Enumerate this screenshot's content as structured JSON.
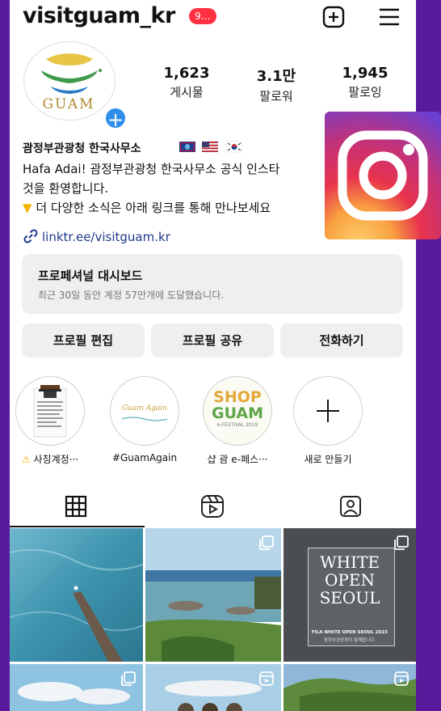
{
  "header": {
    "username": "visitguam_kr",
    "notification_badge": "9…",
    "icons": [
      "plus-square-icon",
      "menu-icon"
    ]
  },
  "profile": {
    "avatar_text": "GUAM",
    "stats": [
      {
        "value": "1,623",
        "label": "게시물"
      },
      {
        "value": "3.1만",
        "label": "팔로워"
      },
      {
        "value": "1,945",
        "label": "팔로잉"
      }
    ],
    "name": "괌정부관광청 한국사무소",
    "bio_lines": [
      "Hafa Adai! 괌정부관광청 한국사무소 공식 인스타",
      "것을 환영합니다.",
      "더 다양한 소식은 아래 링크를 통해 만나보세요"
    ],
    "link": "linktr.ee/visitguam.kr"
  },
  "dashboard": {
    "title": "프로페셔널 대시보드",
    "subtitle": "최근 30일 동안 계정 57만개에 도달했습니다."
  },
  "actions": {
    "edit": "프로필 편집",
    "share": "프로필 공유",
    "call": "전화하기"
  },
  "highlights": [
    {
      "label": "사칭계정···"
    },
    {
      "label": "#GuamAgain",
      "cover_text": "Guam Again"
    },
    {
      "label": "샵 괌 e-페스···",
      "cover_lines": [
        "SHOP",
        "GUAM",
        "e-FESTIVAL 2019"
      ]
    },
    {
      "label": "새로 만들기"
    }
  ],
  "grid": {
    "post3_lines": [
      "WHITE",
      "OPEN",
      "SEOUL"
    ],
    "post3_caption": "FILA WHITE OPEN SEOUL 2023",
    "post3_caption2": "괌정부관광청이 함께합니다."
  },
  "colors": {
    "frame": "#5a1a9c",
    "accent_blue": "#2f8eec",
    "badge_red": "#ff3040",
    "guam_green": "#3a8a3e",
    "guam_gold": "#c9a33c"
  }
}
